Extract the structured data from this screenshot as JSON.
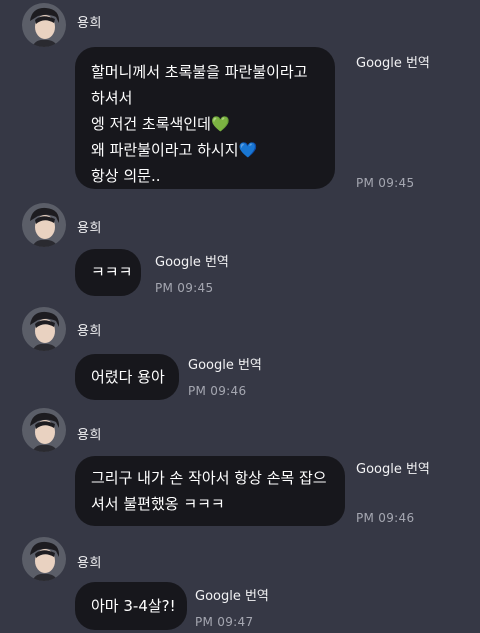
{
  "translate_label": "Google 번역",
  "messages": [
    {
      "sender": "용희",
      "lines": [
        "할머니께서 초록불을 파란불이라고",
        "하셔서",
        "엥 저건 초록색인데",
        "왜 파란불이라고 하시지",
        "항상 의문.."
      ],
      "emoji": {
        "line3": "💚",
        "line4": "💙"
      },
      "time": "PM 09:45"
    },
    {
      "sender": "용희",
      "lines": [
        "ㅋㅋㅋ"
      ],
      "time": "PM 09:45"
    },
    {
      "sender": "용희",
      "lines": [
        "어렸다 용아"
      ],
      "time": "PM 09:46"
    },
    {
      "sender": "용희",
      "lines": [
        "그리구 내가 손 작아서 항상 손목 잡으",
        "셔서 불편했옹 ㅋㅋㅋ"
      ],
      "time": "PM 09:46"
    },
    {
      "sender": "용희",
      "lines": [
        "아마 3-4살?!"
      ],
      "time": "PM 09:47"
    }
  ],
  "colors": {
    "background": "#363845",
    "bubble": "#17171c",
    "time_text": "#a5a7b1",
    "heart_green": "#6ac259",
    "heart_blue": "#5aa9f2"
  },
  "icons": {
    "avatar": "profile-photo"
  }
}
